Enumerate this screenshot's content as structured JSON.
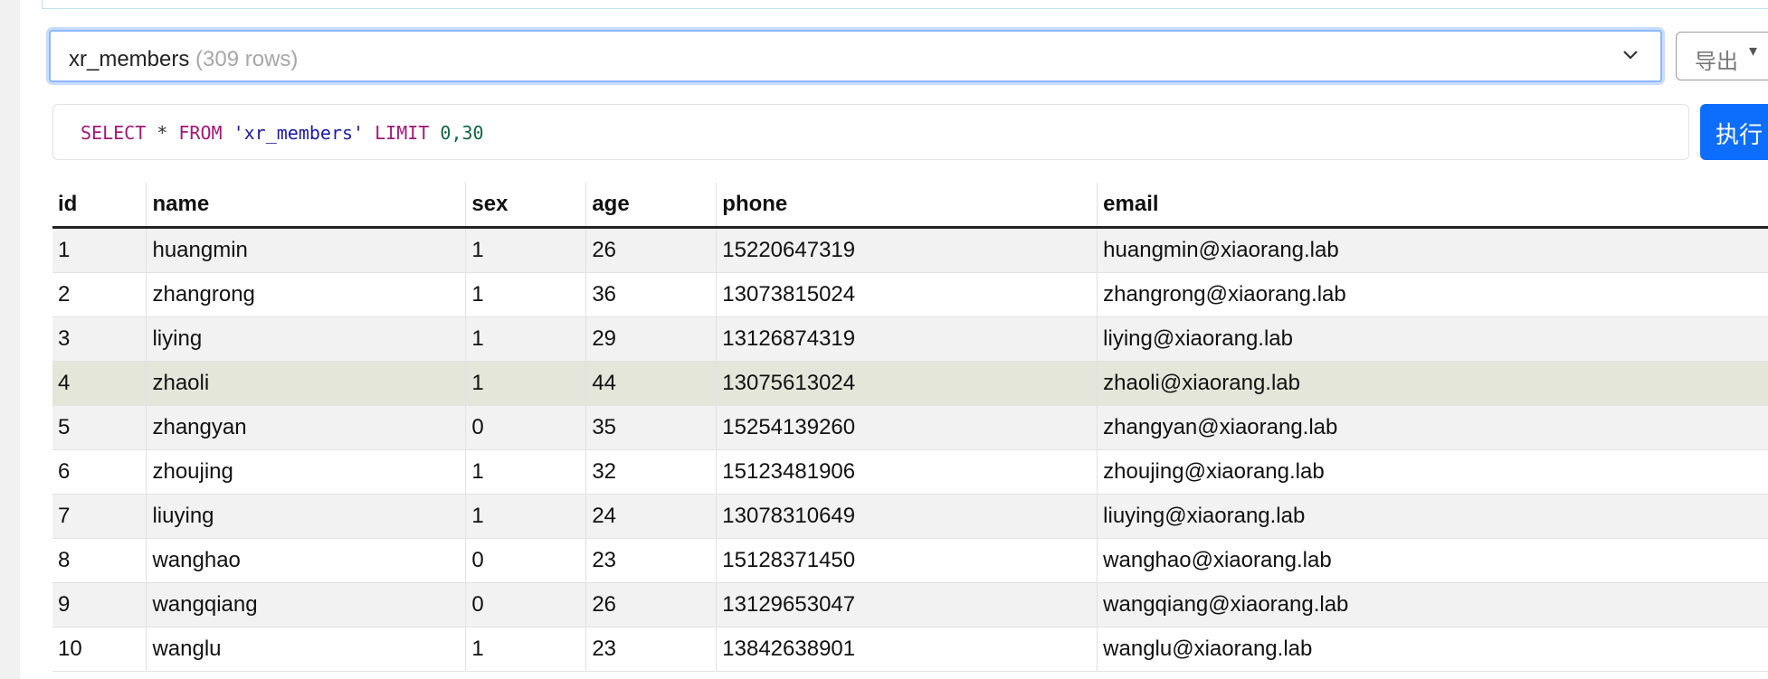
{
  "table_selector": {
    "table_name": "xr_members",
    "row_count": "(309 rows)"
  },
  "export_button": {
    "label": "导出"
  },
  "query": {
    "select": "SELECT",
    "star": " * ",
    "from": "FROM",
    "table": "'xr_members'",
    "limit": "LIMIT",
    "range": "0,30"
  },
  "run_button": {
    "label": "执行"
  },
  "results": {
    "columns": [
      "id",
      "name",
      "sex",
      "age",
      "phone",
      "email"
    ],
    "rows": [
      [
        "1",
        "huangmin",
        "1",
        "26",
        "15220647319",
        "huangmin@xiaorang.lab"
      ],
      [
        "2",
        "zhangrong",
        "1",
        "36",
        "13073815024",
        "zhangrong@xiaorang.lab"
      ],
      [
        "3",
        "liying",
        "1",
        "29",
        "13126874319",
        "liying@xiaorang.lab"
      ],
      [
        "4",
        "zhaoli",
        "1",
        "44",
        "13075613024",
        "zhaoli@xiaorang.lab"
      ],
      [
        "5",
        "zhangyan",
        "0",
        "35",
        "15254139260",
        "zhangyan@xiaorang.lab"
      ],
      [
        "6",
        "zhoujing",
        "1",
        "32",
        "15123481906",
        "zhoujing@xiaorang.lab"
      ],
      [
        "7",
        "liuying",
        "1",
        "24",
        "13078310649",
        "liuying@xiaorang.lab"
      ],
      [
        "8",
        "wanghao",
        "0",
        "23",
        "15128371450",
        "wanghao@xiaorang.lab"
      ],
      [
        "9",
        "wangqiang",
        "0",
        "26",
        "13129653047",
        "wangqiang@xiaorang.lab"
      ],
      [
        "10",
        "wanglu",
        "1",
        "23",
        "13842638901",
        "wanglu@xiaorang.lab"
      ]
    ],
    "highlighted_row": 3
  }
}
